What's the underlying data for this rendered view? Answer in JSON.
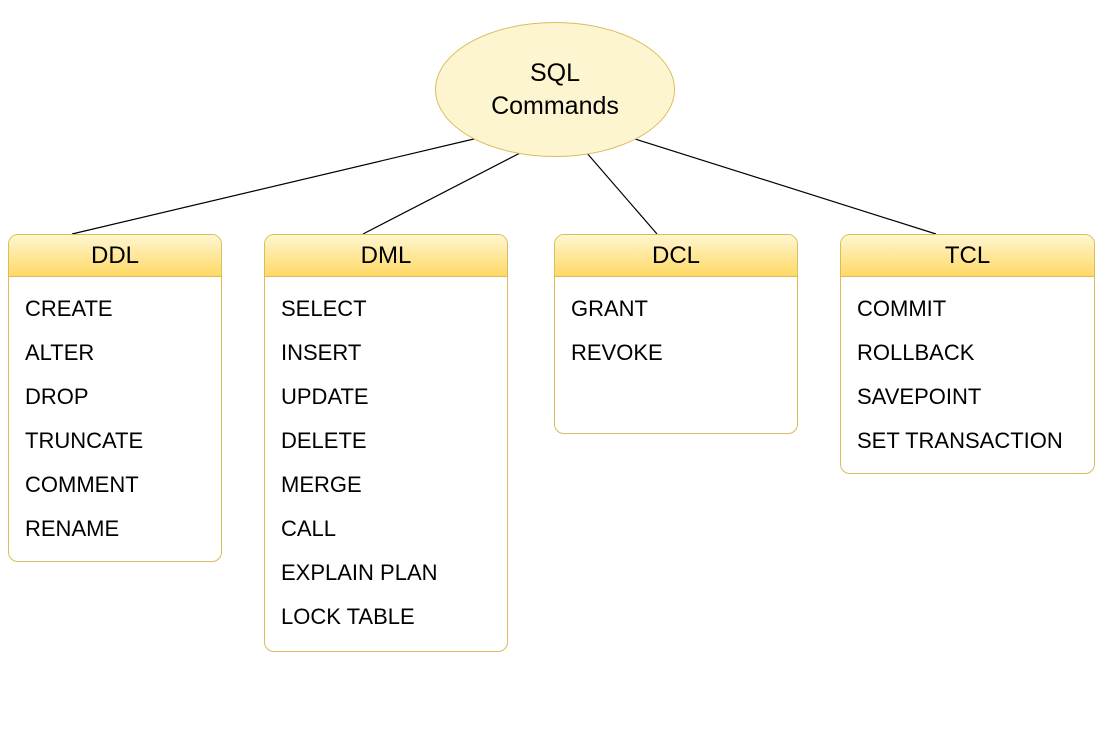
{
  "root": {
    "title_line1": "SQL",
    "title_line2": "Commands"
  },
  "panels": {
    "ddl": {
      "title": "DDL",
      "items": [
        "CREATE",
        "ALTER",
        "DROP",
        "TRUNCATE",
        "COMMENT",
        "RENAME"
      ]
    },
    "dml": {
      "title": "DML",
      "items": [
        "SELECT",
        "INSERT",
        "UPDATE",
        "DELETE",
        "MERGE",
        "CALL",
        "EXPLAIN PLAN",
        "LOCK TABLE"
      ]
    },
    "dcl": {
      "title": "DCL",
      "items": [
        "GRANT",
        "REVOKE"
      ]
    },
    "tcl": {
      "title": "TCL",
      "items": [
        "COMMIT",
        "ROLLBACK",
        "SAVEPOINT",
        "SET TRANSACTION"
      ]
    }
  },
  "colors": {
    "root_fill": "#fdf5d0",
    "border": "#d9bd5c",
    "header_gradient_top": "#fff6d0",
    "header_gradient_bottom": "#ffd966"
  }
}
